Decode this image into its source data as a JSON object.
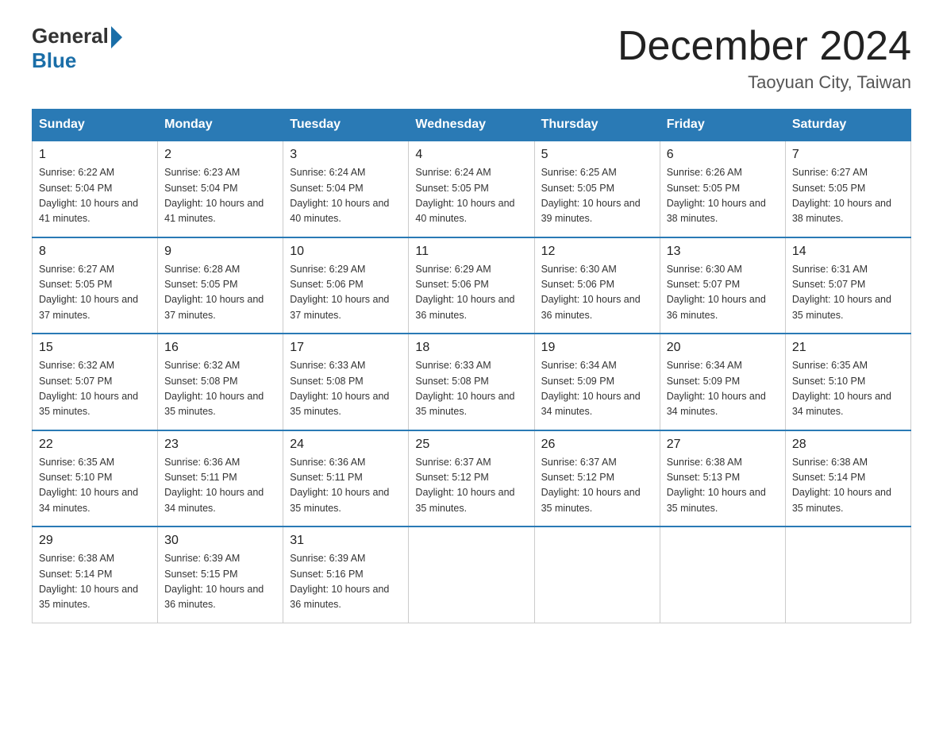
{
  "logo": {
    "general": "General",
    "blue": "Blue"
  },
  "title": "December 2024",
  "subtitle": "Taoyuan City, Taiwan",
  "days_of_week": [
    "Sunday",
    "Monday",
    "Tuesday",
    "Wednesday",
    "Thursday",
    "Friday",
    "Saturday"
  ],
  "weeks": [
    [
      {
        "day": "1",
        "sunrise": "6:22 AM",
        "sunset": "5:04 PM",
        "daylight": "10 hours and 41 minutes."
      },
      {
        "day": "2",
        "sunrise": "6:23 AM",
        "sunset": "5:04 PM",
        "daylight": "10 hours and 41 minutes."
      },
      {
        "day": "3",
        "sunrise": "6:24 AM",
        "sunset": "5:04 PM",
        "daylight": "10 hours and 40 minutes."
      },
      {
        "day": "4",
        "sunrise": "6:24 AM",
        "sunset": "5:05 PM",
        "daylight": "10 hours and 40 minutes."
      },
      {
        "day": "5",
        "sunrise": "6:25 AM",
        "sunset": "5:05 PM",
        "daylight": "10 hours and 39 minutes."
      },
      {
        "day": "6",
        "sunrise": "6:26 AM",
        "sunset": "5:05 PM",
        "daylight": "10 hours and 38 minutes."
      },
      {
        "day": "7",
        "sunrise": "6:27 AM",
        "sunset": "5:05 PM",
        "daylight": "10 hours and 38 minutes."
      }
    ],
    [
      {
        "day": "8",
        "sunrise": "6:27 AM",
        "sunset": "5:05 PM",
        "daylight": "10 hours and 37 minutes."
      },
      {
        "day": "9",
        "sunrise": "6:28 AM",
        "sunset": "5:05 PM",
        "daylight": "10 hours and 37 minutes."
      },
      {
        "day": "10",
        "sunrise": "6:29 AM",
        "sunset": "5:06 PM",
        "daylight": "10 hours and 37 minutes."
      },
      {
        "day": "11",
        "sunrise": "6:29 AM",
        "sunset": "5:06 PM",
        "daylight": "10 hours and 36 minutes."
      },
      {
        "day": "12",
        "sunrise": "6:30 AM",
        "sunset": "5:06 PM",
        "daylight": "10 hours and 36 minutes."
      },
      {
        "day": "13",
        "sunrise": "6:30 AM",
        "sunset": "5:07 PM",
        "daylight": "10 hours and 36 minutes."
      },
      {
        "day": "14",
        "sunrise": "6:31 AM",
        "sunset": "5:07 PM",
        "daylight": "10 hours and 35 minutes."
      }
    ],
    [
      {
        "day": "15",
        "sunrise": "6:32 AM",
        "sunset": "5:07 PM",
        "daylight": "10 hours and 35 minutes."
      },
      {
        "day": "16",
        "sunrise": "6:32 AM",
        "sunset": "5:08 PM",
        "daylight": "10 hours and 35 minutes."
      },
      {
        "day": "17",
        "sunrise": "6:33 AM",
        "sunset": "5:08 PM",
        "daylight": "10 hours and 35 minutes."
      },
      {
        "day": "18",
        "sunrise": "6:33 AM",
        "sunset": "5:08 PM",
        "daylight": "10 hours and 35 minutes."
      },
      {
        "day": "19",
        "sunrise": "6:34 AM",
        "sunset": "5:09 PM",
        "daylight": "10 hours and 34 minutes."
      },
      {
        "day": "20",
        "sunrise": "6:34 AM",
        "sunset": "5:09 PM",
        "daylight": "10 hours and 34 minutes."
      },
      {
        "day": "21",
        "sunrise": "6:35 AM",
        "sunset": "5:10 PM",
        "daylight": "10 hours and 34 minutes."
      }
    ],
    [
      {
        "day": "22",
        "sunrise": "6:35 AM",
        "sunset": "5:10 PM",
        "daylight": "10 hours and 34 minutes."
      },
      {
        "day": "23",
        "sunrise": "6:36 AM",
        "sunset": "5:11 PM",
        "daylight": "10 hours and 34 minutes."
      },
      {
        "day": "24",
        "sunrise": "6:36 AM",
        "sunset": "5:11 PM",
        "daylight": "10 hours and 35 minutes."
      },
      {
        "day": "25",
        "sunrise": "6:37 AM",
        "sunset": "5:12 PM",
        "daylight": "10 hours and 35 minutes."
      },
      {
        "day": "26",
        "sunrise": "6:37 AM",
        "sunset": "5:12 PM",
        "daylight": "10 hours and 35 minutes."
      },
      {
        "day": "27",
        "sunrise": "6:38 AM",
        "sunset": "5:13 PM",
        "daylight": "10 hours and 35 minutes."
      },
      {
        "day": "28",
        "sunrise": "6:38 AM",
        "sunset": "5:14 PM",
        "daylight": "10 hours and 35 minutes."
      }
    ],
    [
      {
        "day": "29",
        "sunrise": "6:38 AM",
        "sunset": "5:14 PM",
        "daylight": "10 hours and 35 minutes."
      },
      {
        "day": "30",
        "sunrise": "6:39 AM",
        "sunset": "5:15 PM",
        "daylight": "10 hours and 36 minutes."
      },
      {
        "day": "31",
        "sunrise": "6:39 AM",
        "sunset": "5:16 PM",
        "daylight": "10 hours and 36 minutes."
      },
      null,
      null,
      null,
      null
    ]
  ]
}
